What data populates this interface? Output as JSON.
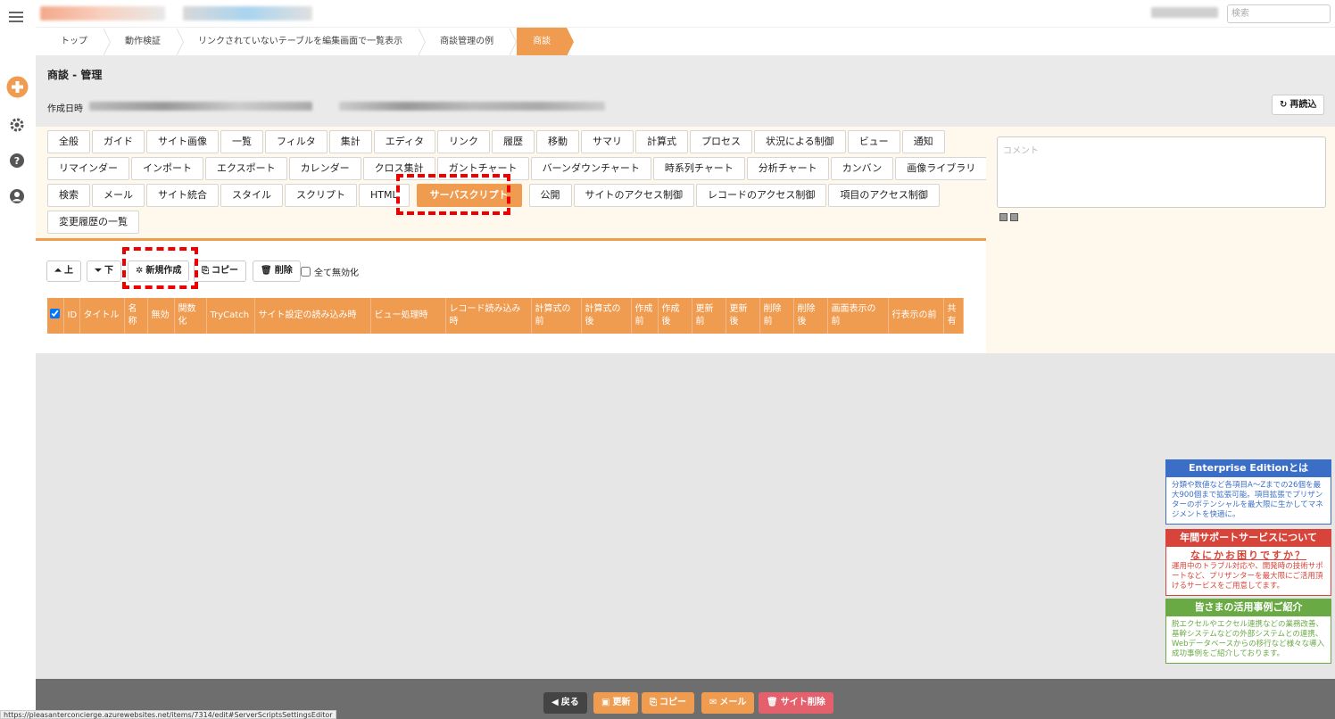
{
  "header": {
    "search_placeholder": "検索"
  },
  "breadcrumb": [
    "トップ",
    "動作検証",
    "リンクされていないテーブルを編集画面で一覧表示",
    "商談管理の例",
    "商談"
  ],
  "page": {
    "title": "商談 - 管理",
    "created_label": "作成日時",
    "reload_label": "再読込"
  },
  "tabs": [
    [
      "全般",
      "ガイド",
      "サイト画像",
      "一覧",
      "フィルタ",
      "集計",
      "エディタ",
      "リンク",
      "履歴",
      "移動",
      "サマリ",
      "計算式",
      "プロセス",
      "状況による制御",
      "ビュー",
      "通知"
    ],
    [
      "リマインダー",
      "インポート",
      "エクスポート",
      "カレンダー",
      "クロス集計",
      "ガントチャート",
      "バーンダウンチャート",
      "時系列チャート",
      "分析チャート",
      "カンバン",
      "画像ライブラリ"
    ],
    [
      "検索",
      "メール",
      "サイト統合",
      "スタイル",
      "スクリプト",
      "HTML",
      "サーバスクリプト",
      "公開",
      "サイトのアクセス制御",
      "レコードのアクセス制御",
      "項目のアクセス制御"
    ],
    [
      "変更履歴の一覧"
    ]
  ],
  "active_tab": "サーバスクリプト",
  "comment": {
    "placeholder": "コメント"
  },
  "toolbar": {
    "up": "上",
    "down": "下",
    "new": "新規作成",
    "copy": "コピー",
    "delete": "削除",
    "disable_all": "全て無効化"
  },
  "table_headers": [
    "ID",
    "タイトル",
    "名称",
    "無効",
    "関数化",
    "TryCatch",
    "サイト設定の読み込み時",
    "ビュー処理時",
    "レコード読み込み時",
    "計算式の前",
    "計算式の後",
    "作成前",
    "作成後",
    "更新前",
    "更新後",
    "削除前",
    "削除後",
    "画面表示の前",
    "行表示の前",
    "共有"
  ],
  "ads": {
    "enterprise": {
      "title": "Enterprise Editionとは",
      "body": "分類や数値など各項目A～Zまでの26個を最大900個まで拡張可能。項目拡張でプリザンターのポテンシャルを最大限に生かしてマネジメントを快適に。",
      "color": "#3b6fc7"
    },
    "support": {
      "title": "年間サポートサービスについて",
      "subtitle": "なにかお困りですか？",
      "body": "運用中のトラブル対応や、開発時の技術サポートなど、プリザンターを最大限にご活用頂けるサービスをご用意してます。",
      "color": "#d9443a"
    },
    "cases": {
      "title": "皆さまの活用事例ご紹介",
      "body": "脱エクセルやエクセル連携などの業務改善、基幹システムなどの外部システムとの連携、Webデータベースからの移行など様々な導入成功事例をご紹介しております。",
      "color": "#6aaa45"
    }
  },
  "footer": {
    "back": "戻る",
    "update": "更新",
    "copy": "コピー",
    "mail": "メール",
    "delete_site": "サイト削除"
  },
  "status_url": "https://pleasanterconcierge.azurewebsites.net/items/7314/edit#ServerScriptsSettingsEditor",
  "colors": {
    "accent": "#ef9c50",
    "highlight": "#e00000",
    "footer_delete": "#e4606d"
  }
}
